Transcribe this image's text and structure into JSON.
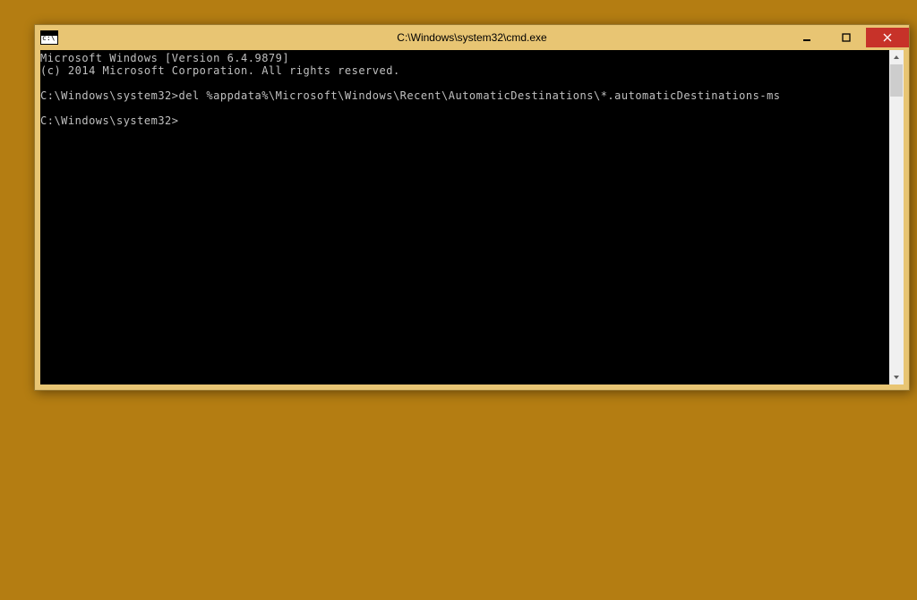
{
  "window": {
    "title": "C:\\Windows\\system32\\cmd.exe"
  },
  "terminal": {
    "line1": "Microsoft Windows [Version 6.4.9879]",
    "line2": "(c) 2014 Microsoft Corporation. All rights reserved.",
    "line3": "C:\\Windows\\system32>del %appdata%\\Microsoft\\Windows\\Recent\\AutomaticDestinations\\*.automaticDestinations-ms",
    "line4": "C:\\Windows\\system32>"
  }
}
